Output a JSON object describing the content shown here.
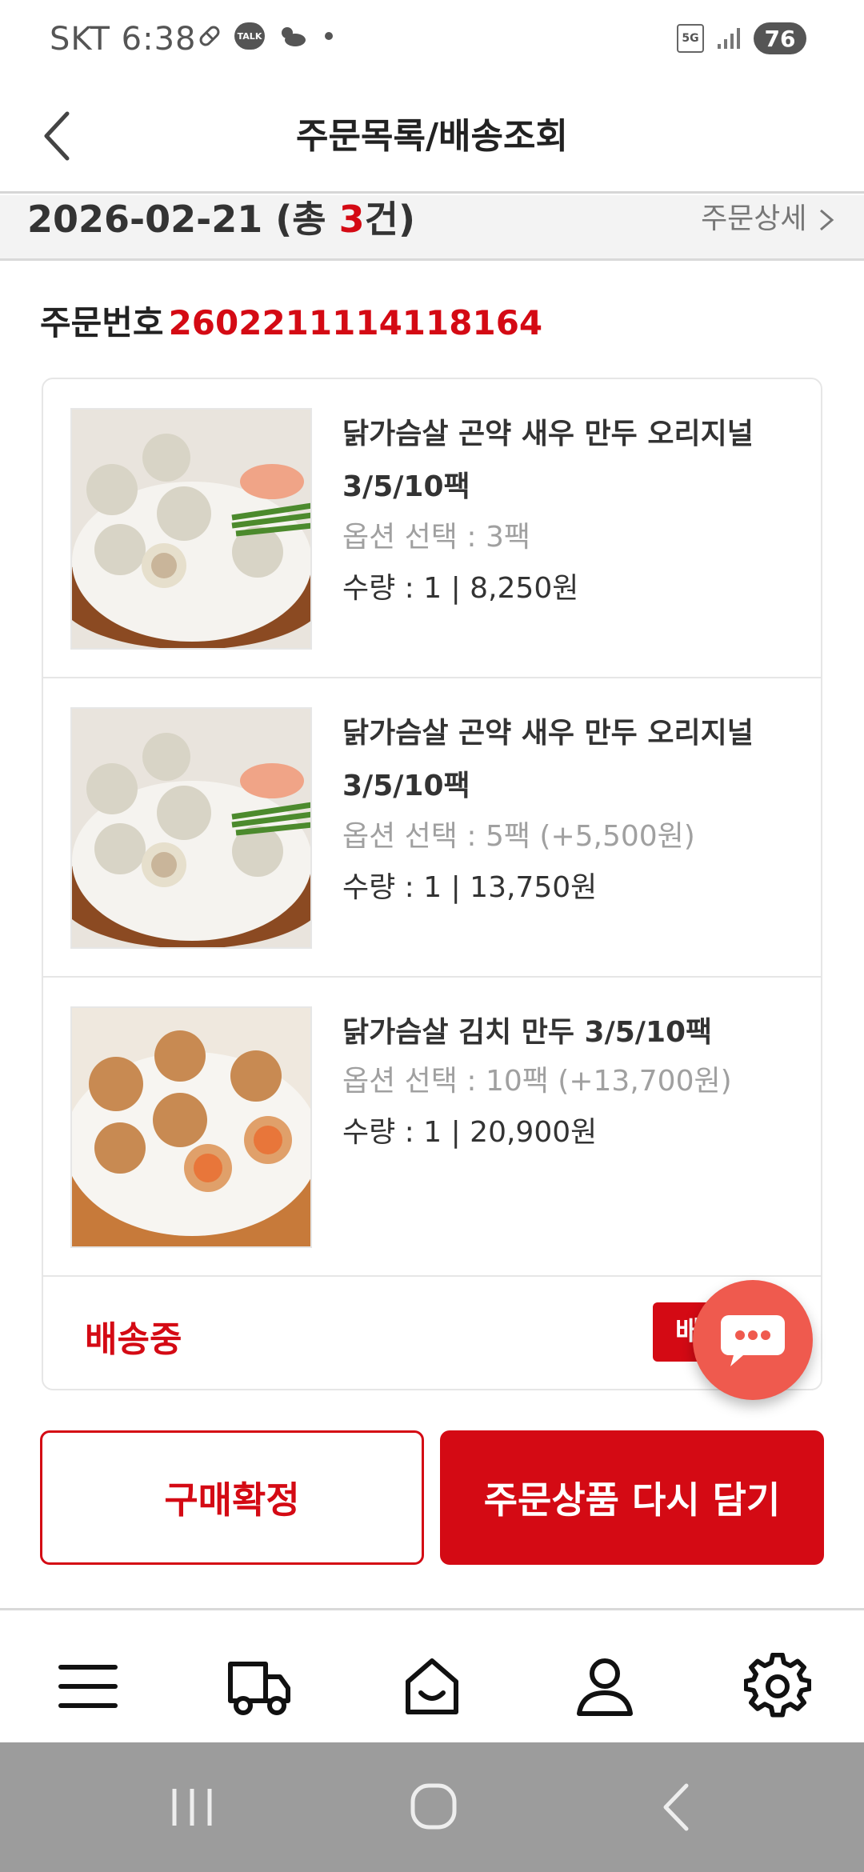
{
  "status_bar": {
    "carrier_time": "SKT 6:38",
    "talk_label": "TALK",
    "network": "5G",
    "battery": "76"
  },
  "header": {
    "title": "주문목록/배송조회"
  },
  "order_summary": {
    "date_prefix": "2026-02-21 (총 ",
    "count": "3",
    "date_suffix": "건)",
    "detail_link": "주문상세"
  },
  "order": {
    "label": "주문번호",
    "number": "2602211114118164"
  },
  "items": [
    {
      "name": "닭가슴살 곤약 새우 만두 오리지널 3/5/10팩",
      "option": "옵션 선택 : 3팩",
      "qty_price": "수량 : 1 | 8,250원"
    },
    {
      "name": "닭가슴살 곤약 새우 만두 오리지널 3/5/10팩",
      "option": "옵션 선택 : 5팩 (+5,500원)",
      "qty_price": "수량 : 1 | 13,750원"
    },
    {
      "name": "닭가슴살 김치 만두 3/5/10팩",
      "option": "옵션 선택 : 10팩 (+13,700원)",
      "qty_price": "수량 : 1 | 20,900원"
    }
  ],
  "delivery": {
    "status": "배송중",
    "track_button": "배"
  },
  "actions": {
    "confirm": "구매확정",
    "recart": "주문상품 다시 담기"
  },
  "colors": {
    "accent": "#d40a14",
    "chat": "#ef5a4e"
  },
  "icons": {
    "bottom_nav": [
      "menu-icon",
      "truck-icon",
      "home-icon",
      "user-icon",
      "gear-icon"
    ]
  }
}
